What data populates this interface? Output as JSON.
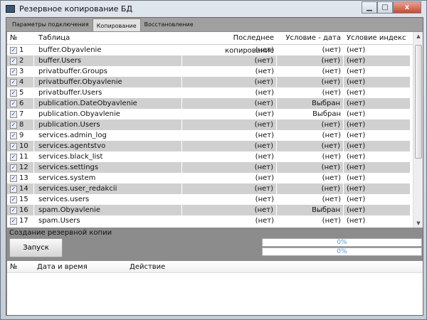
{
  "window": {
    "title": "Резервное копирование БД",
    "minimize": "▁",
    "maximize": "□",
    "close": "x"
  },
  "tabs": [
    "Параметры подключения",
    "Копирование",
    "Восстановление"
  ],
  "table": {
    "headers": [
      "№",
      "Таблица",
      "Последнее копирование",
      "Условие - дата",
      "Условие индекс"
    ],
    "rows": [
      [
        "1",
        "buffer.Obyavlenie",
        "(нет)",
        "(нет)",
        "(нет)"
      ],
      [
        "2",
        "buffer.Users",
        "(нет)",
        "(нет)",
        "(нет)"
      ],
      [
        "3",
        "privatbuffer.Groups",
        "(нет)",
        "(нет)",
        "(нет)"
      ],
      [
        "4",
        "privatbuffer.Obyavlenie",
        "(нет)",
        "(нет)",
        "(нет)"
      ],
      [
        "5",
        "privatbuffer.Users",
        "(нет)",
        "(нет)",
        "(нет)"
      ],
      [
        "6",
        "publication.DateObyavlenie",
        "(нет)",
        "Выбран",
        "(нет)"
      ],
      [
        "7",
        "publication.Obyavlenie",
        "(нет)",
        "Выбран",
        "(нет)"
      ],
      [
        "8",
        "publication.Users",
        "(нет)",
        "(нет)",
        "(нет)"
      ],
      [
        "9",
        "services.admin_log",
        "(нет)",
        "(нет)",
        "(нет)"
      ],
      [
        "10",
        "services.agentstvo",
        "(нет)",
        "(нет)",
        "(нет)"
      ],
      [
        "11",
        "services.black_list",
        "(нет)",
        "(нет)",
        "(нет)"
      ],
      [
        "12",
        "services.settings",
        "(нет)",
        "(нет)",
        "(нет)"
      ],
      [
        "13",
        "services.system",
        "(нет)",
        "(нет)",
        "(нет)"
      ],
      [
        "14",
        "services.user_redakcii",
        "(нет)",
        "(нет)",
        "(нет)"
      ],
      [
        "15",
        "services.users",
        "(нет)",
        "(нет)",
        "(нет)"
      ],
      [
        "16",
        "spam.Obyavlenie",
        "(нет)",
        "Выбран",
        "(нет)"
      ],
      [
        "17",
        "spam.Users",
        "(нет)",
        "(нет)",
        "(нет)"
      ]
    ]
  },
  "backup": {
    "section": "Создание резервной копии",
    "start": "Запуск",
    "progress1": "0%",
    "progress2": "0%",
    "progress1_value": 0,
    "progress2_value": 0
  },
  "log": {
    "headers": [
      "№",
      "Дата и время",
      "Действие"
    ]
  }
}
